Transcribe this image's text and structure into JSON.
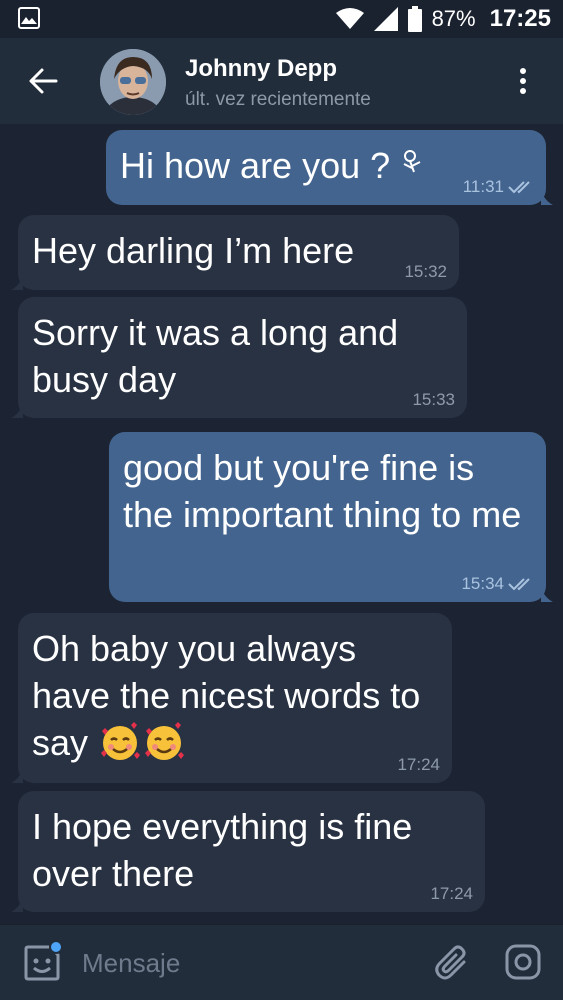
{
  "status_bar": {
    "battery_percent": "87%",
    "time": "17:25"
  },
  "header": {
    "contact_name": "Johnny Depp",
    "last_seen": "últ. vez recientemente"
  },
  "messages": [
    {
      "direction": "out",
      "text": "Hi how are you ?",
      "time": "11:31",
      "read": true
    },
    {
      "direction": "in",
      "text": "Hey darling I’m here",
      "time": "15:32"
    },
    {
      "direction": "in",
      "text": "Sorry it was a long and busy day",
      "time": "15:33"
    },
    {
      "direction": "out",
      "text": "good but you're fine is the important thing to me",
      "time": "15:34",
      "read": true
    },
    {
      "direction": "in",
      "text": "Oh baby you always have the nicest words to say",
      "time": "17:24",
      "emoji": "smiling-face-with-hearts-icon"
    },
    {
      "direction": "in",
      "text": "I hope everything is fine over there",
      "time": "17:24"
    }
  ],
  "composer": {
    "placeholder": "Mensaje"
  },
  "colors": {
    "background": "#1c2433",
    "header": "#222d3b",
    "incoming_bubble": "#283242",
    "outgoing_bubble": "#43648e",
    "accent": "#4ea4f6"
  }
}
